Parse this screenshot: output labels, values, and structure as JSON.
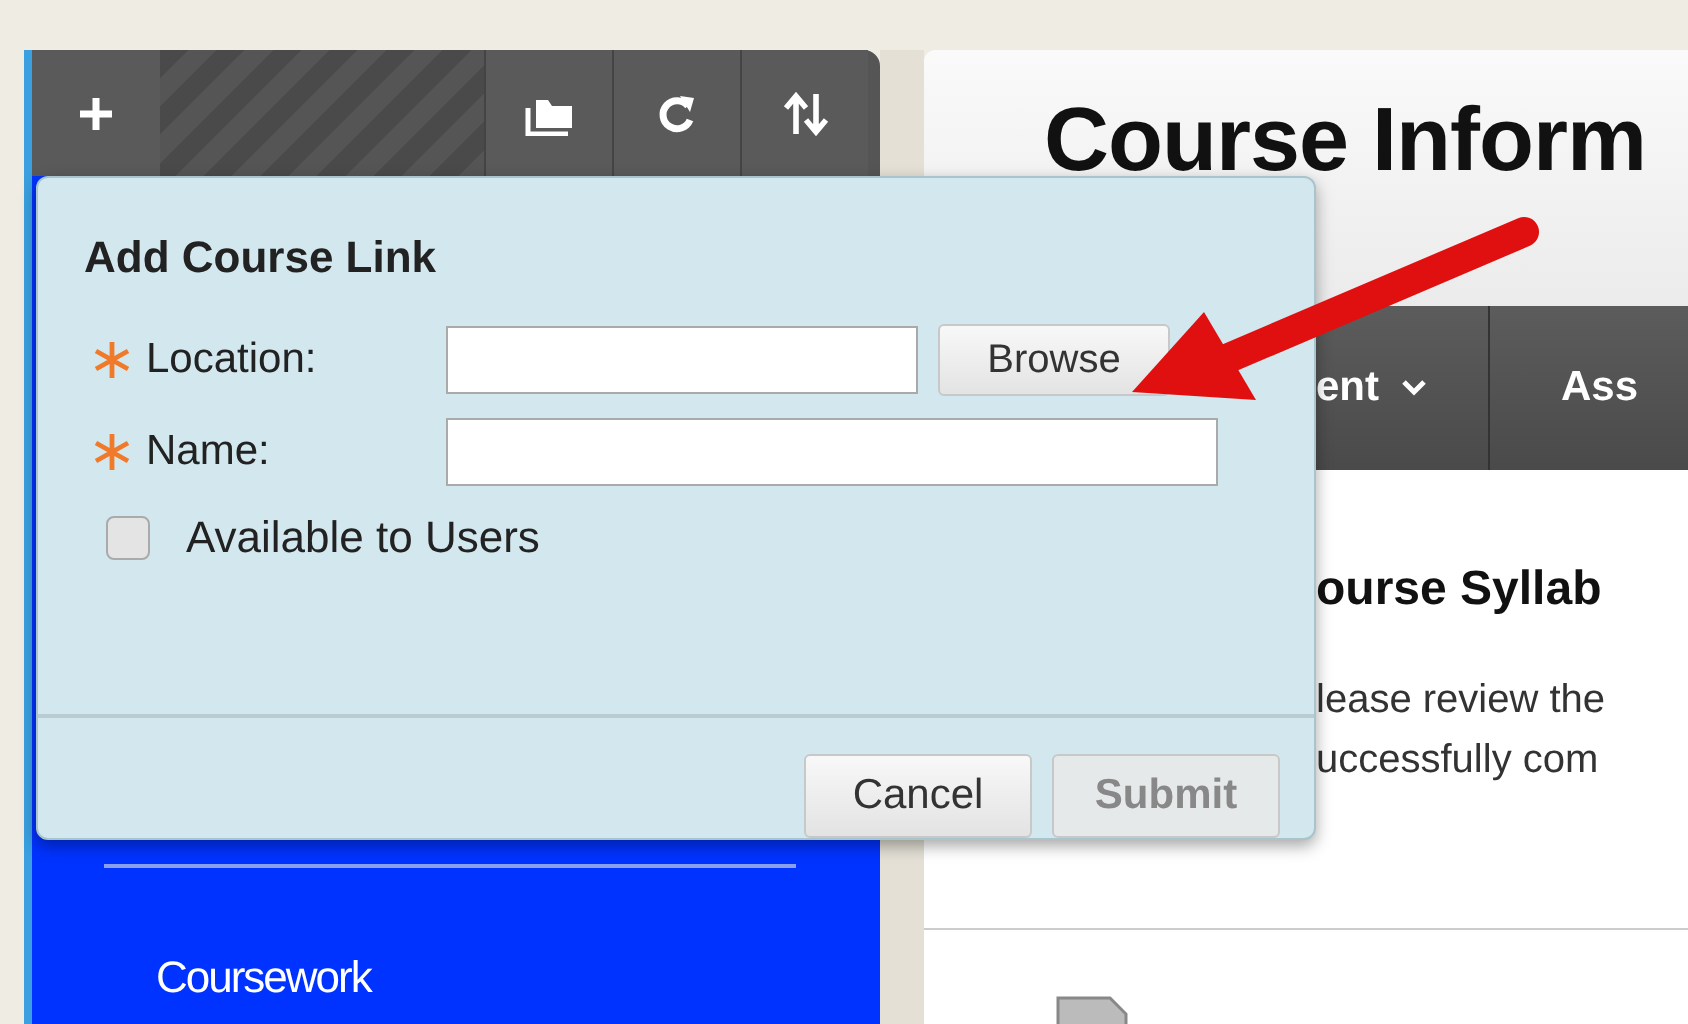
{
  "sidebar": {
    "items": [
      {
        "label": "Coursework"
      }
    ]
  },
  "page": {
    "title": "Course Inform",
    "nav": [
      {
        "label": "ent",
        "dropdown": true
      },
      {
        "label": "Ass",
        "dropdown": false
      }
    ],
    "section_title": "ourse Syllab",
    "lines": [
      "lease review the",
      "uccessfully com"
    ]
  },
  "dialog": {
    "title": "Add Course Link",
    "fields": [
      {
        "label": "Location:",
        "required": true,
        "kind": "browse",
        "button": "Browse"
      },
      {
        "label": "Name:",
        "required": true,
        "kind": "text"
      }
    ],
    "checkbox": {
      "label": "Available to Users",
      "checked": false
    },
    "buttons": [
      {
        "label": "Cancel",
        "disabled": false
      },
      {
        "label": "Submit",
        "disabled": true
      }
    ]
  }
}
